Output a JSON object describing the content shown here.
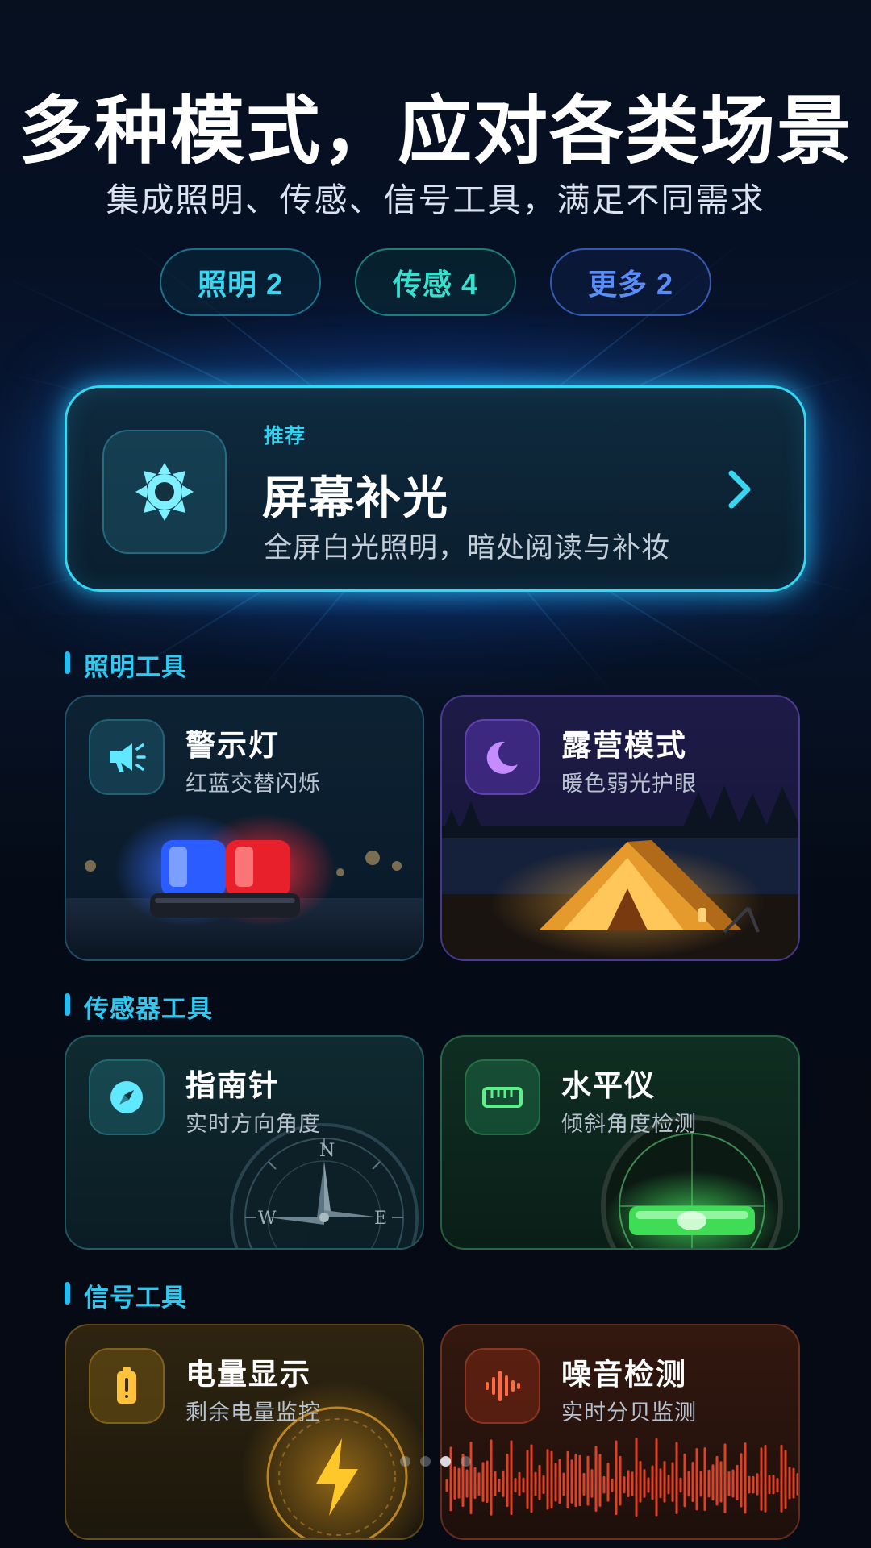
{
  "hero": {
    "title": "多种模式，应对各类场景",
    "subtitle": "集成照明、传感、信号工具，满足不同需求"
  },
  "filters": [
    {
      "label": "照明 2",
      "color": "#3ad6f0"
    },
    {
      "label": "传感 4",
      "color": "#35e0cf"
    },
    {
      "label": "更多 2",
      "color": "#5a8df5"
    }
  ],
  "featured": {
    "tag": "推荐",
    "title": "屏幕补光",
    "description": "全屏白光照明，暗处阅读与补妆",
    "icon": "brightness-icon",
    "accent": "#33d8f5"
  },
  "sections": {
    "lighting": {
      "label": "照明工具",
      "cards": [
        {
          "title": "警示灯",
          "subtitle": "红蓝交替闪烁",
          "icon": "megaphone-icon"
        },
        {
          "title": "露营模式",
          "subtitle": "暖色弱光护眼",
          "icon": "moon-icon"
        }
      ]
    },
    "sensor": {
      "label": "传感器工具",
      "cards": [
        {
          "title": "指南针",
          "subtitle": "实时方向角度",
          "icon": "compass-icon"
        },
        {
          "title": "水平仪",
          "subtitle": "倾斜角度检测",
          "icon": "ruler-icon"
        }
      ]
    },
    "signal": {
      "label": "信号工具",
      "cards": [
        {
          "title": "电量显示",
          "subtitle": "剩余电量监控",
          "icon": "battery-icon"
        },
        {
          "title": "噪音检测",
          "subtitle": "实时分贝监测",
          "icon": "waveform-icon"
        }
      ]
    }
  },
  "compass_labels": {
    "n": "N",
    "e": "E",
    "w": "W"
  },
  "pager": {
    "total": 4,
    "active_index": 2
  }
}
